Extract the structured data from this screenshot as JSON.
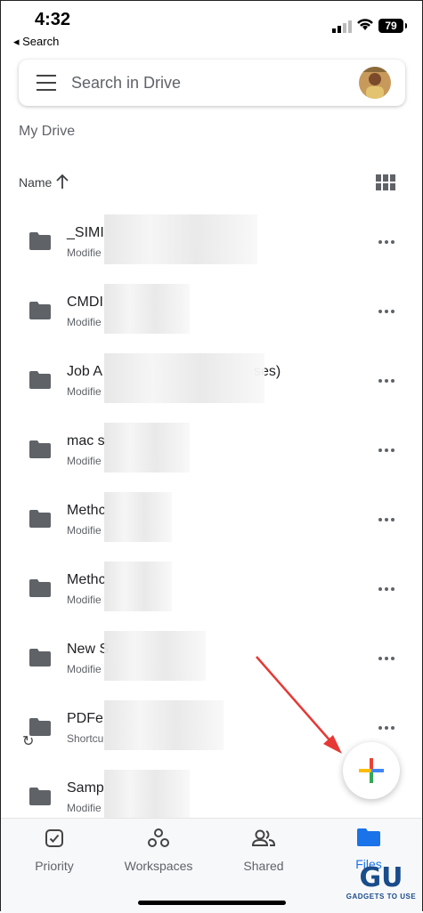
{
  "status_bar": {
    "time": "4:32",
    "back_label": "◂ Search",
    "battery": "79"
  },
  "search": {
    "placeholder": "Search in Drive"
  },
  "breadcrumb": "My Drive",
  "sort": {
    "label": "Name"
  },
  "files": [
    {
      "name": "_SIMI",
      "meta": "Modifie",
      "type": "folder"
    },
    {
      "name": "CMDI",
      "meta": "Modifie",
      "type": "folder"
    },
    {
      "name": "Job A",
      "meta": "Modifie",
      "type": "folder",
      "suffix": "ses)"
    },
    {
      "name": "mac s",
      "meta": "Modifie",
      "type": "folder"
    },
    {
      "name": "Methc",
      "meta": "Modifie",
      "type": "folder"
    },
    {
      "name": "Methc",
      "meta": "Modifie",
      "type": "folder"
    },
    {
      "name": "New S",
      "meta": "Modifie",
      "type": "folder"
    },
    {
      "name": "PDFe",
      "meta": "Shortcu",
      "type": "shortcut"
    },
    {
      "name": "Samp",
      "meta": "Modifie",
      "type": "folder"
    }
  ],
  "tabs": [
    {
      "label": "Priority",
      "icon": "check-square-icon"
    },
    {
      "label": "Workspaces",
      "icon": "workspaces-icon"
    },
    {
      "label": "Shared",
      "icon": "people-icon"
    },
    {
      "label": "Files",
      "icon": "folder-icon",
      "active": true
    }
  ],
  "watermark": {
    "logo": "GU",
    "text": "GADGETS TO USE"
  },
  "colors": {
    "accent": "#1a73e8",
    "folder": "#5f6368",
    "annotation_arrow": "#e53935"
  }
}
